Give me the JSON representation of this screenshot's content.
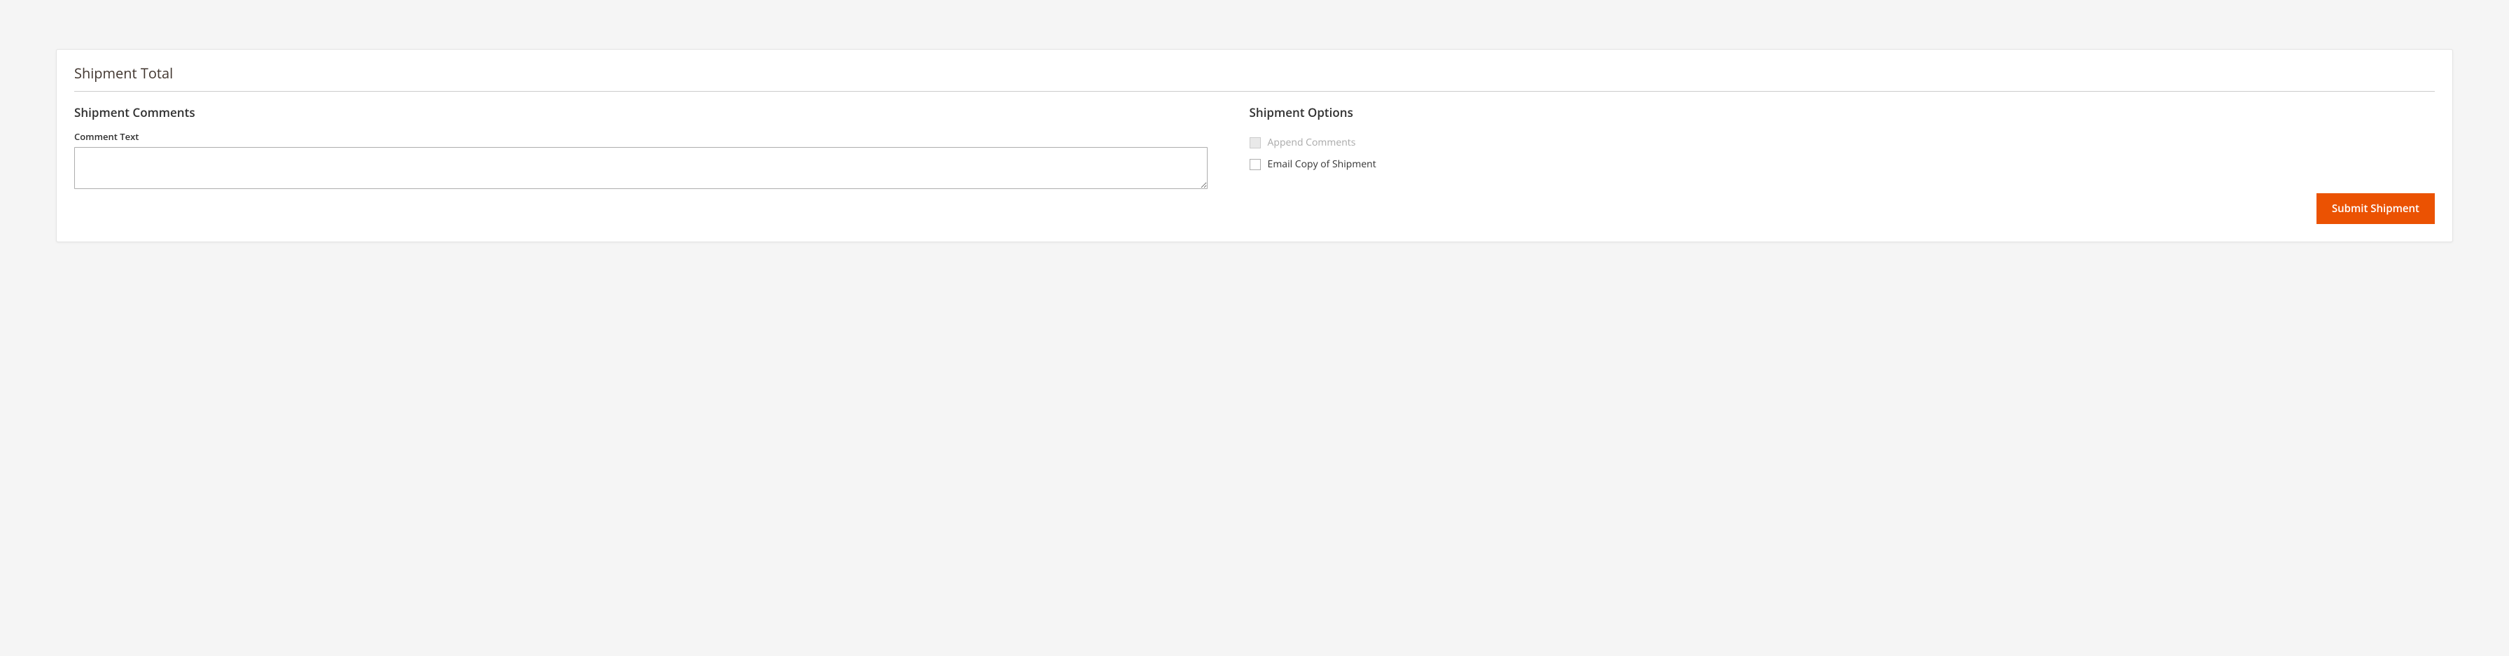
{
  "panel": {
    "title": "Shipment Total"
  },
  "comments": {
    "heading": "Shipment Comments",
    "field_label": "Comment Text",
    "value": ""
  },
  "options": {
    "heading": "Shipment Options",
    "append_comments": {
      "label": "Append Comments",
      "checked": false,
      "disabled": true
    },
    "email_copy": {
      "label": "Email Copy of Shipment",
      "checked": false,
      "disabled": false
    }
  },
  "actions": {
    "submit_label": "Submit Shipment"
  }
}
